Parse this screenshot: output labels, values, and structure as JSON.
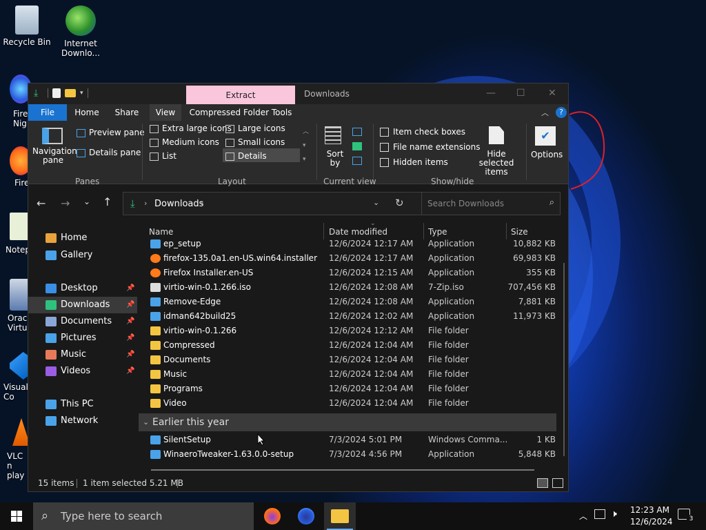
{
  "desktop": {
    "icons": [
      {
        "label": "Recycle Bin"
      },
      {
        "label": "Internet Downlo..."
      }
    ],
    "cut_labels": [
      "Fire Nigh",
      "Fire",
      "Notep",
      "Oracl Virtu",
      "Visual Co",
      "VLC n play"
    ]
  },
  "window": {
    "context_tab": "Extract",
    "title": "Downloads",
    "controls": {
      "minimize": "—",
      "maximize": "☐",
      "close": "✕"
    },
    "tabs": [
      "File",
      "Home",
      "Share",
      "View",
      "Compressed Folder Tools"
    ],
    "ribbon": {
      "panes": {
        "navigation_pane": "Navigation pane",
        "preview_pane": "Preview pane",
        "details_pane": "Details pane",
        "group_label": "Panes"
      },
      "layout": {
        "extra_large": "Extra large icons",
        "large": "Large icons",
        "medium": "Medium icons",
        "small": "Small icons",
        "list": "List",
        "details": "Details",
        "group_label": "Layout"
      },
      "current_view": {
        "sort_by": "Sort by",
        "group_label": "Current view"
      },
      "show_hide": {
        "item_check_boxes": "Item check boxes",
        "file_name_extensions": "File name extensions",
        "hidden_items": "Hidden items",
        "hide_selected": "Hide selected items",
        "group_label": "Show/hide"
      },
      "options": "Options"
    },
    "address": {
      "location": "Downloads"
    },
    "search": {
      "placeholder": "Search Downloads"
    },
    "sidebar": [
      {
        "label": "Home",
        "icon": "home-icon",
        "color": "#e8a33d"
      },
      {
        "label": "Gallery",
        "icon": "gallery-icon",
        "color": "#4aa3e8"
      },
      {
        "label": "Desktop",
        "icon": "desktop-icon",
        "color": "#3a8ee6",
        "pinned": true
      },
      {
        "label": "Downloads",
        "icon": "download-icon",
        "color": "#2ec27e",
        "pinned": true,
        "selected": true
      },
      {
        "label": "Documents",
        "icon": "documents-icon",
        "color": "#8aa6d6",
        "pinned": true
      },
      {
        "label": "Pictures",
        "icon": "pictures-icon",
        "color": "#4aa3e8",
        "pinned": true
      },
      {
        "label": "Music",
        "icon": "music-icon",
        "color": "#e87a5a",
        "pinned": true
      },
      {
        "label": "Videos",
        "icon": "videos-icon",
        "color": "#9b5de5",
        "pinned": true
      },
      {
        "label": "This PC",
        "icon": "pc-icon",
        "color": "#4aa3e8"
      },
      {
        "label": "Network",
        "icon": "network-icon",
        "color": "#4aa3e8"
      }
    ],
    "columns": {
      "name": "Name",
      "date": "Date modified",
      "type": "Type",
      "size": "Size"
    },
    "files": [
      {
        "name": "ep_setup",
        "date": "12/6/2024 12:17 AM",
        "type": "Application",
        "size": "10,882 KB",
        "icon": "app-icon"
      },
      {
        "name": "firefox-135.0a1.en-US.win64.installer",
        "date": "12/6/2024 12:17 AM",
        "type": "Application",
        "size": "69,983 KB",
        "icon": "firefox-icon"
      },
      {
        "name": "Firefox Installer.en-US",
        "date": "12/6/2024 12:15 AM",
        "type": "Application",
        "size": "355 KB",
        "icon": "firefox-icon"
      },
      {
        "name": "virtio-win-0.1.266.iso",
        "date": "12/6/2024 12:08 AM",
        "type": "7-Zip.iso",
        "size": "707,456 KB",
        "icon": "file-icon"
      },
      {
        "name": "Remove-Edge",
        "date": "12/6/2024 12:08 AM",
        "type": "Application",
        "size": "7,881 KB",
        "icon": "app-icon"
      },
      {
        "name": "idman642build25",
        "date": "12/6/2024 12:02 AM",
        "type": "Application",
        "size": "11,973 KB",
        "icon": "app-icon"
      },
      {
        "name": "virtio-win-0.1.266",
        "date": "12/6/2024 12:12 AM",
        "type": "File folder",
        "size": "",
        "icon": "folder-icon"
      },
      {
        "name": "Compressed",
        "date": "12/6/2024 12:04 AM",
        "type": "File folder",
        "size": "",
        "icon": "folder-icon"
      },
      {
        "name": "Documents",
        "date": "12/6/2024 12:04 AM",
        "type": "File folder",
        "size": "",
        "icon": "folder-icon"
      },
      {
        "name": "Music",
        "date": "12/6/2024 12:04 AM",
        "type": "File folder",
        "size": "",
        "icon": "folder-icon"
      },
      {
        "name": "Programs",
        "date": "12/6/2024 12:04 AM",
        "type": "File folder",
        "size": "",
        "icon": "folder-icon"
      },
      {
        "name": "Video",
        "date": "12/6/2024 12:04 AM",
        "type": "File folder",
        "size": "",
        "icon": "folder-icon"
      }
    ],
    "group_earlier": "Earlier this year",
    "files_earlier": [
      {
        "name": "SilentSetup",
        "date": "7/3/2024 5:01 PM",
        "type": "Windows Comma...",
        "size": "1 KB",
        "icon": "app-icon"
      },
      {
        "name": "WinaeroTweaker-1.63.0.0-setup",
        "date": "7/3/2024 4:56 PM",
        "type": "Application",
        "size": "5,848 KB",
        "icon": "app-icon"
      }
    ],
    "status": {
      "items": "15 items",
      "selected": "1 item selected  5.21 MB"
    }
  },
  "taskbar": {
    "search_placeholder": "Type here to search",
    "time": "12:23 AM",
    "date": "12/6/2024",
    "notification_count": "3"
  },
  "colors": {
    "accent": "#0078d4",
    "folder": "#f4c542",
    "context_tab": "#f9c6dc"
  }
}
